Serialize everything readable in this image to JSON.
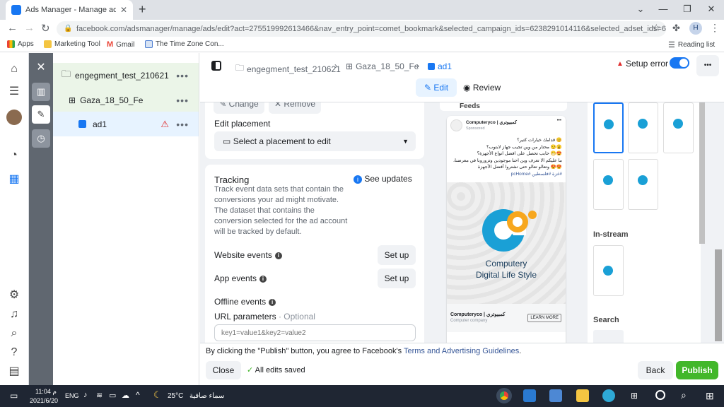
{
  "browser": {
    "tab_title": "Ads Manager - Manage ads - Ad",
    "new_tab": "+",
    "url": "facebook.com/adsmanager/manage/ads/edit?act=275519992613466&nav_entry_point=comet_bookmark&selected_campaign_ids=6238291014116&selected_adset_ids=62...",
    "profile_initial": "H",
    "bookmarks": [
      "Apps",
      "Marketing Tool",
      "Gmail",
      "The Time Zone Con..."
    ],
    "reading_list": "Reading list"
  },
  "tree": {
    "campaign": "engegment_test_210621",
    "adset": "Gaza_18_50_Fe",
    "ad": "ad1"
  },
  "header": {
    "crumb_campaign": "engegment_test_210621",
    "crumb_adset": "Gaza_18_50_Fe",
    "crumb_ad": "ad1",
    "setup_error": "Setup error",
    "edit_tab": "Edit",
    "review_tab": "Review",
    "more": "•••"
  },
  "form": {
    "change_btn": "Change",
    "remove_btn": "Remove",
    "edit_placement_label": "Edit placement",
    "placement_select": "Select a placement to edit",
    "tracking_title": "Tracking",
    "see_updates": "See updates",
    "tracking_desc": "Track event data sets that contain the conversions your ad might motivate. The dataset that contains the conversion selected for the ad account will be tracked by default.",
    "website_events": "Website events",
    "app_events": "App events",
    "offline_events": "Offline events",
    "setup_btn": "Set up",
    "url_params": "URL parameters",
    "optional": "· Optional",
    "url_placeholder": "key1=value1&key2=value2"
  },
  "preview": {
    "feeds_label": "Feeds",
    "page_name": "Computeryco | كمبيوتري",
    "sponsored": "Sponsored",
    "post_line1": "😊 قدامك خيارات كتير؟",
    "post_line2": "😮😏 محتار من وين تجيب جهاز لابتوب؟",
    "post_line3": "😍😁 حابب تحصل على افضل انواع الأجهزة؟",
    "post_line4": "ما عليكم الا تعرف وين احنا موجودين وتزورونا في معرضنا،",
    "post_line5": "😍😍 وتعالو تعالو حتى تشتروا أفضل الأجهزة",
    "post_line6": "#غزة #فلسطين #pcHome",
    "brand1": "Computery",
    "brand2": "Digital Life Style",
    "footer_name": "Computeryco | كمبيوتري",
    "footer_sub": "Computer company",
    "learn_more": "LEARN MORE",
    "menu": "•••"
  },
  "thumbs": {
    "instream": "In-stream",
    "search": "Search"
  },
  "footer": {
    "agree_text": "By clicking the \"Publish\" button, you agree to Facebook's",
    "terms_link": "Terms and Advertising Guidelines",
    "period": ".",
    "close": "Close",
    "saved": "All edits saved",
    "back": "Back",
    "publish": "Publish"
  },
  "taskbar": {
    "time": "11:04 م",
    "date": "2021/6/20",
    "lang": "ENG",
    "temp": "25°C",
    "weather": "سماء صافية"
  },
  "colors": {
    "accent": "#1877f2",
    "publish": "#42b72a",
    "error": "#e02c2c",
    "brand_blue": "#1aa0d6",
    "brand_orange": "#f7a71e"
  }
}
